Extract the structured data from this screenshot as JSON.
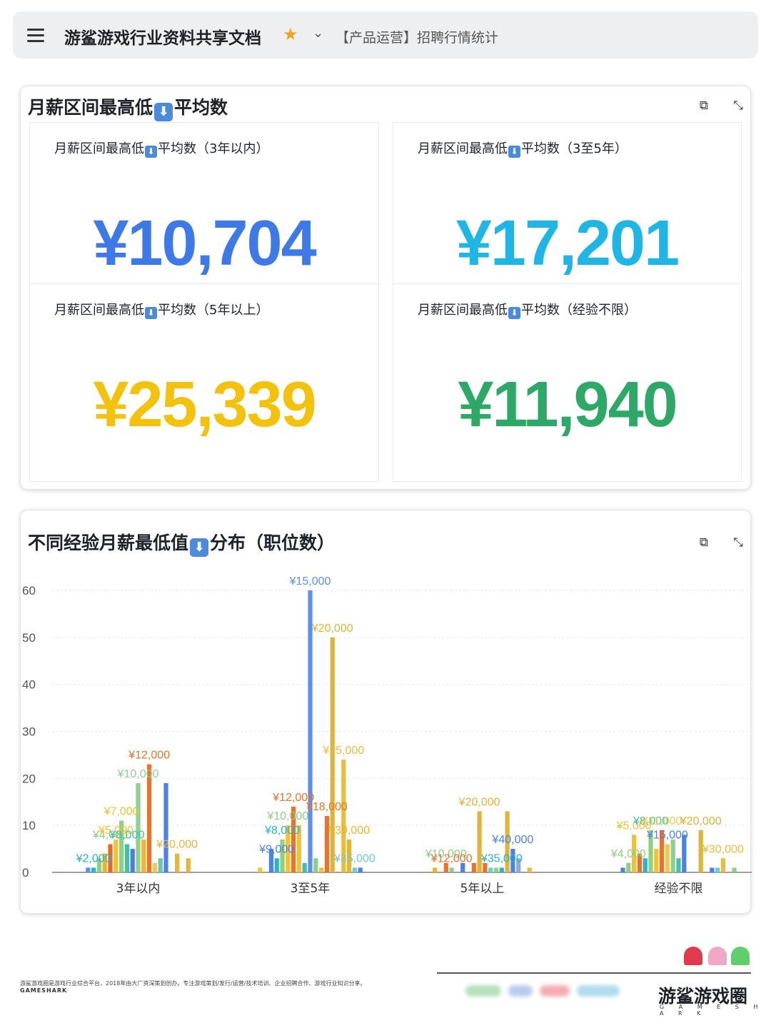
{
  "header": {
    "title": "游鲨游戏行业资料共享文档",
    "breadcrumb": "【产品运营】招聘行情统计",
    "star_icon": "star-icon",
    "menu_icon": "menu-icon"
  },
  "kpi_card": {
    "title_part1": "月薪区间最高低",
    "title_part2": "平均数",
    "arrow_glyph": "⬇",
    "tiles": [
      {
        "label_a": "月薪区间最高低",
        "label_b": "平均数（3年以内）",
        "value": "¥10,704",
        "color": "#3d7ae8"
      },
      {
        "label_a": "月薪区间最高低",
        "label_b": "平均数（3至5年）",
        "value": "¥17,201",
        "color": "#1fb6e6"
      },
      {
        "label_a": "月薪区间最高低",
        "label_b": "平均数（5年以上）",
        "value": "¥25,339",
        "color": "#f2c20c"
      },
      {
        "label_a": "月薪区间最高低",
        "label_b": "平均数（经验不限）",
        "value": "¥11,940",
        "color": "#2ea866"
      }
    ]
  },
  "chart_card": {
    "title_part1": "不同经验月薪最低值",
    "title_part2": "分布（职位数）"
  },
  "chart_data": {
    "type": "bar",
    "ylim": [
      0,
      60
    ],
    "yticks": [
      0,
      10,
      20,
      30,
      40,
      50,
      60
    ],
    "categories": [
      "3年以内",
      "3至5年",
      "5年以上",
      "经验不限"
    ],
    "groups": [
      {
        "category": "3年以内",
        "bars": [
          {
            "v": 1,
            "c": "#5b8ff0"
          },
          {
            "v": 1,
            "c": "#2bb3c9"
          },
          {
            "v": 3,
            "c": "#8cd17d"
          },
          {
            "v": 4,
            "c": "#e8b62b"
          },
          {
            "v": 6,
            "c": "#e86a1f"
          },
          {
            "v": 7,
            "c": "#f2c230"
          },
          {
            "v": 11,
            "c": "#8ad18a"
          },
          {
            "v": 6,
            "c": "#3fc3a8"
          },
          {
            "v": 5,
            "c": "#4b7de0"
          },
          {
            "v": 19,
            "c": "#8fd18f"
          },
          {
            "v": 7,
            "c": "#f0b32d"
          },
          {
            "v": 23,
            "c": "#e8732a"
          },
          {
            "v": 2,
            "c": "#f2c94c"
          },
          {
            "v": 3,
            "c": "#66c9a9"
          },
          {
            "v": 19,
            "c": "#4a82ea"
          },
          {
            "v": 0,
            "c": "#ffffff"
          },
          {
            "v": 4,
            "c": "#e6b53c"
          },
          {
            "v": 0,
            "c": "#ffffff"
          },
          {
            "v": 3,
            "c": "#e6b53c"
          }
        ]
      },
      {
        "category": "3至5年",
        "bars": [
          {
            "v": 1,
            "c": "#f2c230"
          },
          {
            "v": 0,
            "c": "#ffffff"
          },
          {
            "v": 5,
            "c": "#4a82ea"
          },
          {
            "v": 3,
            "c": "#2bb3c9"
          },
          {
            "v": 7,
            "c": "#8cd17d"
          },
          {
            "v": 10,
            "c": "#f2c230"
          },
          {
            "v": 14,
            "c": "#e8732a"
          },
          {
            "v": 10,
            "c": "#f2c230"
          },
          {
            "v": 2,
            "c": "#3fc3a8"
          },
          {
            "v": 60,
            "c": "#5b8ff0"
          },
          {
            "v": 3,
            "c": "#8ad18a"
          },
          {
            "v": 1,
            "c": "#f2c230"
          },
          {
            "v": 12,
            "c": "#e8732a"
          },
          {
            "v": 50,
            "c": "#e0b43a"
          },
          {
            "v": 0,
            "c": "#ffffff"
          },
          {
            "v": 24,
            "c": "#e6be3c"
          },
          {
            "v": 7,
            "c": "#e8b62b"
          },
          {
            "v": 1,
            "c": "#6ec9d8"
          },
          {
            "v": 1,
            "c": "#4a82ea"
          }
        ]
      },
      {
        "category": "5年以上",
        "bars": [
          {
            "v": 1,
            "c": "#e8b62b"
          },
          {
            "v": 0,
            "c": "#ffffff"
          },
          {
            "v": 2,
            "c": "#e8732a"
          },
          {
            "v": 1,
            "c": "#8cd17d"
          },
          {
            "v": 0,
            "c": "#ffffff"
          },
          {
            "v": 2,
            "c": "#4a82ea"
          },
          {
            "v": 0,
            "c": "#ffffff"
          },
          {
            "v": 2,
            "c": "#e8732a"
          },
          {
            "v": 13,
            "c": "#e0b43a"
          },
          {
            "v": 2,
            "c": "#e8732a"
          },
          {
            "v": 1,
            "c": "#6ec9d8"
          },
          {
            "v": 1,
            "c": "#8cd17d"
          },
          {
            "v": 1,
            "c": "#2bb3c9"
          },
          {
            "v": 13,
            "c": "#e0b43a"
          },
          {
            "v": 5,
            "c": "#4a82ea"
          },
          {
            "v": 3,
            "c": "#8fa9e0"
          },
          {
            "v": 0,
            "c": "#ffffff"
          },
          {
            "v": 1,
            "c": "#e6be3c"
          }
        ]
      },
      {
        "category": "经验不限",
        "bars": [
          {
            "v": 1,
            "c": "#4a82ea"
          },
          {
            "v": 2,
            "c": "#8cd17d"
          },
          {
            "v": 8,
            "c": "#f2c230"
          },
          {
            "v": 4,
            "c": "#e8732a"
          },
          {
            "v": 3,
            "c": "#2bb3c9"
          },
          {
            "v": 9,
            "c": "#8cd17d"
          },
          {
            "v": 5,
            "c": "#f2c230"
          },
          {
            "v": 9,
            "c": "#e8732a"
          },
          {
            "v": 6,
            "c": "#f2c94c"
          },
          {
            "v": 7,
            "c": "#8ad18a"
          },
          {
            "v": 3,
            "c": "#3fc3a8"
          },
          {
            "v": 8,
            "c": "#4a82ea"
          },
          {
            "v": 0,
            "c": "#ffffff"
          },
          {
            "v": 0,
            "c": "#ffffff"
          },
          {
            "v": 9,
            "c": "#e0b43a"
          },
          {
            "v": 0,
            "c": "#ffffff"
          },
          {
            "v": 1,
            "c": "#4a82ea"
          },
          {
            "v": 1,
            "c": "#6ec9d8"
          },
          {
            "v": 3,
            "c": "#e6be3c"
          },
          {
            "v": 0,
            "c": "#ffffff"
          },
          {
            "v": 1,
            "c": "#8cd17d"
          }
        ]
      }
    ],
    "data_labels": [
      {
        "group": 0,
        "bar": 1,
        "text": "¥2,000",
        "color": "#2bb3c9"
      },
      {
        "group": 0,
        "bar": 4,
        "text": "¥4,000",
        "color": "#8cd17d"
      },
      {
        "group": 0,
        "bar": 5,
        "text": "¥5,000",
        "color": "#f2c230"
      },
      {
        "group": 0,
        "bar": 6,
        "text": "¥7,000",
        "color": "#f2c230"
      },
      {
        "group": 0,
        "bar": 7,
        "text": "¥8,000",
        "color": "#3fc3a8"
      },
      {
        "group": 0,
        "bar": 9,
        "text": "¥10,000",
        "color": "#8fd18f"
      },
      {
        "group": 0,
        "bar": 11,
        "text": "¥12,000",
        "color": "#e8732a"
      },
      {
        "group": 0,
        "bar": 16,
        "text": "¥20,000",
        "color": "#e6b53c"
      },
      {
        "group": 1,
        "bar": 3,
        "text": "¥9,000",
        "color": "#4a82ea"
      },
      {
        "group": 1,
        "bar": 4,
        "text": "¥8,000",
        "color": "#2bb3c9"
      },
      {
        "group": 1,
        "bar": 5,
        "text": "¥10,000",
        "color": "#8cd17d"
      },
      {
        "group": 1,
        "bar": 6,
        "text": "¥12,000",
        "color": "#e8732a"
      },
      {
        "group": 1,
        "bar": 9,
        "text": "¥15,000",
        "color": "#5b8ff0"
      },
      {
        "group": 1,
        "bar": 12,
        "text": "¥18,000",
        "color": "#e8732a"
      },
      {
        "group": 1,
        "bar": 13,
        "text": "¥20,000",
        "color": "#e0b43a"
      },
      {
        "group": 1,
        "bar": 15,
        "text": "¥25,000",
        "color": "#e6be3c"
      },
      {
        "group": 1,
        "bar": 16,
        "text": "¥30,000",
        "color": "#e8b62b"
      },
      {
        "group": 1,
        "bar": 17,
        "text": "¥35,000",
        "color": "#6ec9d8"
      },
      {
        "group": 2,
        "bar": 2,
        "text": "¥10,000",
        "color": "#8cd17d"
      },
      {
        "group": 2,
        "bar": 3,
        "text": "¥12,000",
        "color": "#e8732a"
      },
      {
        "group": 2,
        "bar": 8,
        "text": "¥20,000",
        "color": "#e0b43a"
      },
      {
        "group": 2,
        "bar": 12,
        "text": "¥35,000",
        "color": "#2bb3c9"
      },
      {
        "group": 2,
        "bar": 14,
        "text": "¥40,000",
        "color": "#4a82ea"
      },
      {
        "group": 3,
        "bar": 1,
        "text": "¥4,000",
        "color": "#8cd17d"
      },
      {
        "group": 3,
        "bar": 2,
        "text": "¥5,000",
        "color": "#f2c230"
      },
      {
        "group": 3,
        "bar": 5,
        "text": "¥8,000",
        "color": "#3fc3a8"
      },
      {
        "group": 3,
        "bar": 7,
        "text": "¥11,000",
        "color": "#f2c94c"
      },
      {
        "group": 3,
        "bar": 8,
        "text": "¥15,000",
        "color": "#4a82ea"
      },
      {
        "group": 3,
        "bar": 14,
        "text": "¥20,000",
        "color": "#e0b43a"
      },
      {
        "group": 3,
        "bar": 18,
        "text": "¥30,000",
        "color": "#e6be3c"
      }
    ]
  },
  "footer": {
    "description": "游鲨游戏圈是游戏行业综合平台，2018年由大厂资深策划创办。专注游戏策划/发行/运营/技术培训、企业招聘合作、游戏行业知识分享。",
    "brand_en": "GAMESHARK",
    "logo_cn": "游鲨游戏圈",
    "logo_en": "G A M E S H A R K"
  }
}
